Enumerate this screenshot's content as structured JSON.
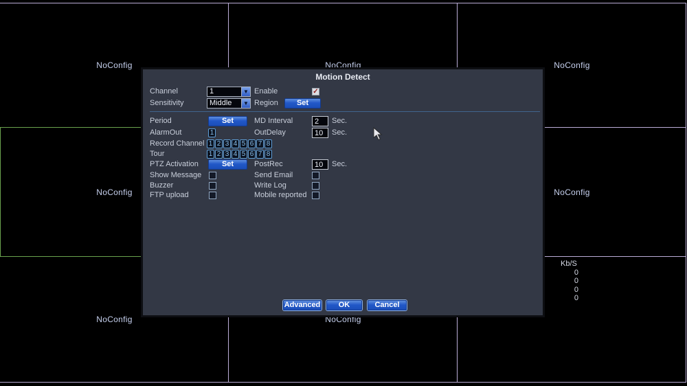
{
  "colors": {
    "grid_line": "#bcaed8",
    "selected_channel_border": "#6aa34e",
    "panel_background": "#333845",
    "accent_blue": "#2258c8",
    "enable_check": "#8f1d1d"
  },
  "video_grid": {
    "no_config_label": "NoConfig",
    "bitrate": {
      "header": "Kb/S",
      "values": [
        "0",
        "0",
        "0",
        "0"
      ]
    }
  },
  "dialog": {
    "title": "Motion Detect",
    "fields": {
      "channel": {
        "label": "Channel",
        "value": "1"
      },
      "enable": {
        "label": "Enable",
        "checked": true
      },
      "sensitivity": {
        "label": "Sensitivity",
        "value": "Middle"
      },
      "region": {
        "label": "Region",
        "button": "Set"
      },
      "period": {
        "label": "Period",
        "button": "Set"
      },
      "md_interval": {
        "label": "MD Interval",
        "value": "2",
        "unit": "Sec."
      },
      "alarm_out": {
        "label": "AlarmOut",
        "chips": [
          "1"
        ]
      },
      "out_delay": {
        "label": "OutDelay",
        "value": "10",
        "unit": "Sec."
      },
      "record_channel": {
        "label": "Record Channel",
        "chips": [
          "1",
          "2",
          "3",
          "4",
          "5",
          "6",
          "7",
          "8"
        ]
      },
      "tour": {
        "label": "Tour",
        "chips": [
          "1",
          "2",
          "3",
          "4",
          "5",
          "6",
          "7",
          "8"
        ]
      },
      "ptz_activation": {
        "label": "PTZ Activation",
        "button": "Set"
      },
      "post_rec": {
        "label": "PostRec",
        "value": "10",
        "unit": "Sec."
      },
      "show_message": {
        "label": "Show Message",
        "checked": false
      },
      "send_email": {
        "label": "Send Email",
        "checked": false
      },
      "buzzer": {
        "label": "Buzzer",
        "checked": false
      },
      "write_log": {
        "label": "Write Log",
        "checked": false
      },
      "ftp_upload": {
        "label": "FTP upload",
        "checked": false
      },
      "mobile_reported": {
        "label": "Mobile reported",
        "checked": false
      }
    },
    "buttons": {
      "advanced": "Advanced",
      "ok": "OK",
      "cancel": "Cancel"
    },
    "dropdown_arrow_icon": "▼"
  }
}
